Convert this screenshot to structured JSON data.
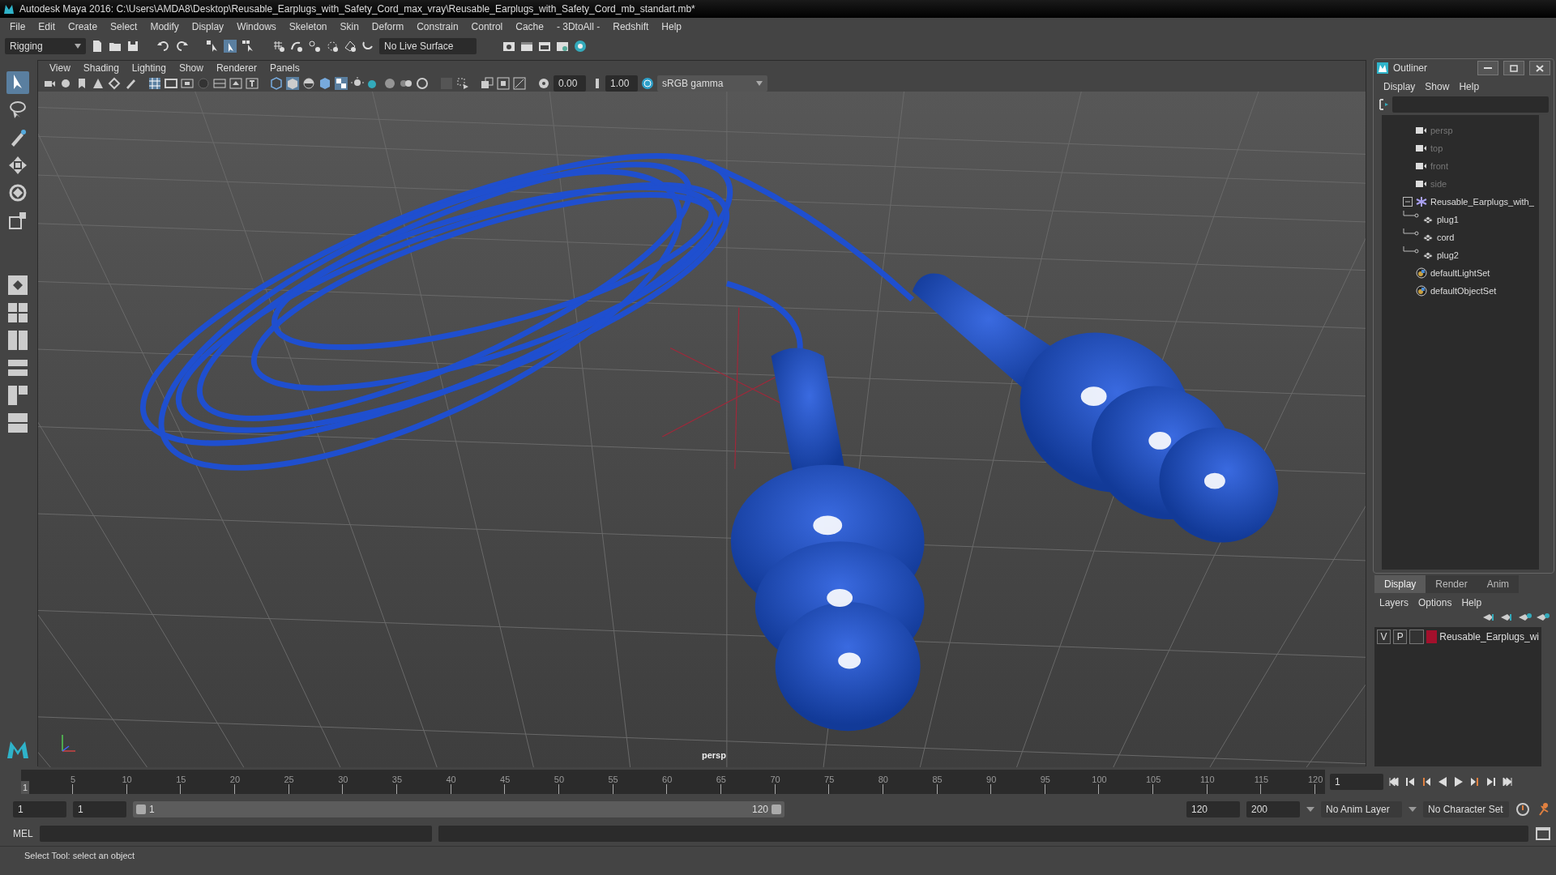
{
  "window": {
    "title": "Autodesk Maya 2016: C:\\Users\\AMDA8\\Desktop\\Reusable_Earplugs_with_Safety_Cord_max_vray\\Reusable_Earplugs_with_Safety_Cord_mb_standart.mb*"
  },
  "menu_bar": [
    "File",
    "Edit",
    "Create",
    "Select",
    "Modify",
    "Display",
    "Windows",
    "Skeleton",
    "Skin",
    "Deform",
    "Constrain",
    "Control",
    "Cache",
    "- 3DtoAll -",
    "Redshift",
    "Help"
  ],
  "status_line": {
    "mode_dropdown": "Rigging",
    "live_surface": "No Live Surface"
  },
  "viewport": {
    "panel_menu": [
      "View",
      "Shading",
      "Lighting",
      "Show",
      "Renderer",
      "Panels"
    ],
    "near_value": "0.00",
    "exposure_value": "1.00",
    "color_space": "sRGB gamma",
    "camera_label": "persp"
  },
  "outliner": {
    "title": "Outliner",
    "menu": [
      "Display",
      "Show",
      "Help"
    ],
    "items": [
      {
        "label": "persp",
        "kind": "camera"
      },
      {
        "label": "top",
        "kind": "camera"
      },
      {
        "label": "front",
        "kind": "camera"
      },
      {
        "label": "side",
        "kind": "camera"
      },
      {
        "label": "Reusable_Earplugs_with_",
        "kind": "group",
        "expanded": true,
        "children": [
          {
            "label": "plug1",
            "kind": "mesh"
          },
          {
            "label": "cord",
            "kind": "mesh"
          },
          {
            "label": "plug2",
            "kind": "mesh"
          }
        ]
      },
      {
        "label": "defaultLightSet",
        "kind": "set"
      },
      {
        "label": "defaultObjectSet",
        "kind": "set"
      }
    ]
  },
  "layer_editor": {
    "tabs": [
      {
        "label": "Display",
        "selected": true
      },
      {
        "label": "Render",
        "selected": false
      },
      {
        "label": "Anim",
        "selected": false
      }
    ],
    "menu": [
      "Layers",
      "Options",
      "Help"
    ],
    "layers": [
      {
        "visibility": "V",
        "playback": "P",
        "color": "#a3102c",
        "name": "Reusable_Earplugs_wi"
      }
    ]
  },
  "timeline": {
    "ticks": [
      "5",
      "10",
      "15",
      "20",
      "25",
      "30",
      "35",
      "40",
      "45",
      "50",
      "55",
      "60",
      "65",
      "70",
      "75",
      "80",
      "85",
      "90",
      "95",
      "100",
      "105",
      "110",
      "115",
      "120"
    ],
    "current_frame": "1",
    "level": 0,
    "frame_field": "1"
  },
  "range": {
    "start": "1",
    "playback_start": "1",
    "slider_start": "1",
    "slider_end": "120",
    "level": 1,
    "playback_end": "120",
    "end": "200",
    "anim_layer": "No Anim Layer",
    "character_set": "No Character Set"
  },
  "command_line": {
    "label": "MEL"
  },
  "help_line": "Select Tool: select an object"
}
